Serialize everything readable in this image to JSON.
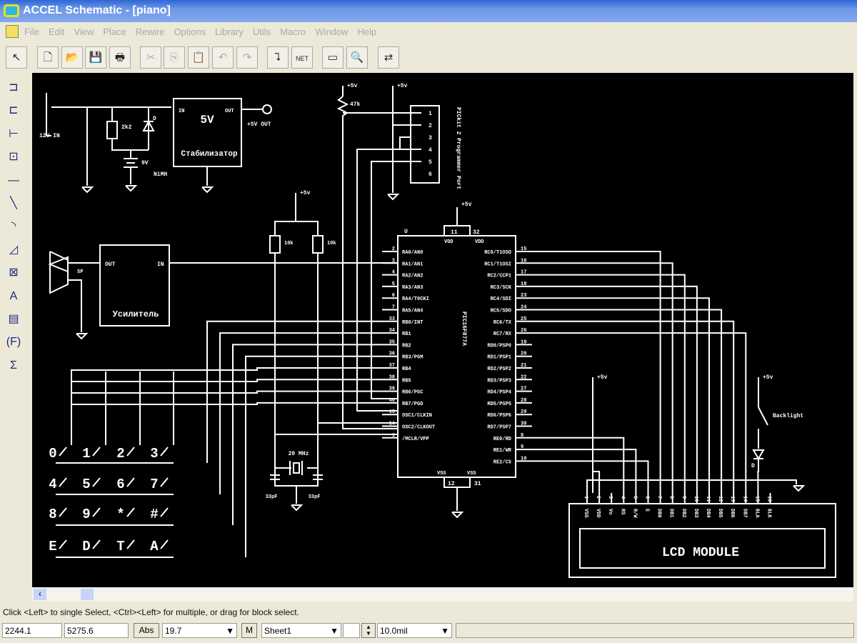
{
  "window": {
    "title": "ACCEL Schematic - [piano]"
  },
  "menu": [
    "File",
    "Edit",
    "View",
    "Place",
    "Rewire",
    "Options",
    "Library",
    "Utils",
    "Macro",
    "Window",
    "Help"
  ],
  "toolbar": [
    {
      "icon": "select-arrow-icon",
      "g": "↖",
      "dis": false
    },
    {
      "icon": "new-file-icon",
      "g": "🗋",
      "dis": false
    },
    {
      "icon": "open-folder-icon",
      "g": "📂",
      "dis": false
    },
    {
      "icon": "save-icon",
      "g": "💾",
      "dis": false
    },
    {
      "icon": "print-icon",
      "g": "🖶",
      "dis": false
    },
    {
      "icon": "cut-icon",
      "g": "✂",
      "dis": true
    },
    {
      "icon": "copy-icon",
      "g": "⎘",
      "dis": true
    },
    {
      "icon": "paste-icon",
      "g": "📋",
      "dis": true
    },
    {
      "icon": "undo-icon",
      "g": "↶",
      "dis": true
    },
    {
      "icon": "redo-icon",
      "g": "↷",
      "dis": true
    },
    {
      "icon": "wire-icon",
      "g": "⮧",
      "dis": false
    },
    {
      "icon": "net-rename-icon",
      "g": "NET",
      "dis": false
    },
    {
      "icon": "ruler-icon",
      "g": "▭",
      "dis": false
    },
    {
      "icon": "zoom-icon",
      "g": "🔍",
      "dis": false
    },
    {
      "icon": "port-swap-icon",
      "g": "⇄",
      "dis": false
    }
  ],
  "left_tools": [
    {
      "icon": "place-part-icon",
      "g": "⊐"
    },
    {
      "icon": "place-pin-icon",
      "g": "⊏"
    },
    {
      "icon": "place-bus-icon",
      "g": "⊢"
    },
    {
      "icon": "place-port-icon",
      "g": "⊡"
    },
    {
      "icon": "place-line-icon",
      "g": "—"
    },
    {
      "icon": "draw-line-icon",
      "g": "╲"
    },
    {
      "icon": "arc-icon",
      "g": "◝"
    },
    {
      "icon": "polygon-icon",
      "g": "◿"
    },
    {
      "icon": "box-icon",
      "g": "⊠"
    },
    {
      "icon": "text-icon",
      "g": "A"
    },
    {
      "icon": "attribute-icon",
      "g": "▤"
    },
    {
      "icon": "field-icon",
      "g": "(F)"
    },
    {
      "icon": "sum-icon",
      "g": "Σ"
    }
  ],
  "schematic": {
    "power": {
      "in_label": "12V IN",
      "r": "2k2",
      "d": "D",
      "bat": "9V",
      "bat_type": "NiMH",
      "reg_value": "5V",
      "reg_in": "IN",
      "reg_out": "OUT",
      "out_label": "+5V OUT",
      "reg_name": "Стабилизатор"
    },
    "programmer": {
      "vcc": "+5v",
      "vcc2": "+5v",
      "r": "47k",
      "title": "PICkit 2 Programmer Port",
      "pins": [
        "1",
        "2",
        "3",
        "4",
        "5",
        "6"
      ]
    },
    "pullups": {
      "vcc": "+5v",
      "r1": "10k",
      "r2": "10k"
    },
    "amp": {
      "out": "OUT",
      "in": "IN",
      "sp": "SP",
      "name": "Усилитель"
    },
    "mcu": {
      "ref": "U",
      "part": "PIC16F877A",
      "vcc": "+5v",
      "vdd1": "VDD",
      "vdd2": "VDD",
      "vss1": "VSS",
      "vss2": "VSS",
      "vdd_pins": [
        "11",
        "32"
      ],
      "vss_pins": [
        "12",
        "31"
      ],
      "left_pins": [
        [
          "2",
          "RA0/AN0"
        ],
        [
          "3",
          "RA1/AN1"
        ],
        [
          "4",
          "RA2/AN2"
        ],
        [
          "5",
          "RA3/AN3"
        ],
        [
          "6",
          "RA4/T0CKI"
        ],
        [
          "7",
          "RA5/AN4"
        ],
        [
          "33",
          "RB0/INT"
        ],
        [
          "34",
          "RB1"
        ],
        [
          "35",
          "RB2"
        ],
        [
          "36",
          "RB3/PGM"
        ],
        [
          "37",
          "RB4"
        ],
        [
          "38",
          "RB5"
        ],
        [
          "39",
          "RB6/PGC"
        ],
        [
          "40",
          "RB7/PGD"
        ],
        [
          "13",
          "OSC1/CLKIN"
        ],
        [
          "14",
          "OSC2/CLKOUT"
        ],
        [
          "1",
          "/MCLR/VPP"
        ]
      ],
      "right_pins": [
        [
          "15",
          "RC0/T1OSO"
        ],
        [
          "16",
          "RC1/T1OSI"
        ],
        [
          "17",
          "RC2/CCP1"
        ],
        [
          "18",
          "RC3/SCK"
        ],
        [
          "23",
          "RC4/SDI"
        ],
        [
          "24",
          "RC5/SDO"
        ],
        [
          "25",
          "RC6/TX"
        ],
        [
          "26",
          "RC7/RX"
        ],
        [
          "19",
          "RD0/PSP0"
        ],
        [
          "20",
          "RD1/PSP1"
        ],
        [
          "21",
          "RD2/PSP2"
        ],
        [
          "22",
          "RD3/PSP3"
        ],
        [
          "27",
          "RD4/PSP4"
        ],
        [
          "28",
          "RD5/PSP5"
        ],
        [
          "29",
          "RD6/PSP6"
        ],
        [
          "30",
          "RD7/PSP7"
        ],
        [
          "8",
          "RE0/RD"
        ],
        [
          "9",
          "RE1/WR"
        ],
        [
          "10",
          "RE2/CS"
        ]
      ]
    },
    "crystal": {
      "freq": "20 MHz",
      "c1": "33pF",
      "c2": "33pF"
    },
    "keypad": [
      [
        "0",
        "1",
        "2",
        "3"
      ],
      [
        "4",
        "5",
        "6",
        "7"
      ],
      [
        "8",
        "9",
        "*",
        "#"
      ],
      [
        "E",
        "D",
        "T",
        "A"
      ]
    ],
    "lcd": {
      "vcc": "+5v",
      "bl_vcc": "+5v",
      "backlight": "Backlight",
      "d": "D",
      "title": "LCD MODULE",
      "pin_numbers": [
        "1",
        "2",
        "3",
        "4",
        "5",
        "6",
        "7",
        "8",
        "9",
        "10",
        "11",
        "12",
        "13",
        "14",
        "15",
        "16"
      ],
      "pin_names": [
        "VSS",
        "VDD",
        "Vo",
        "RS",
        "R/W",
        "E",
        "DB0",
        "DB1",
        "DB2",
        "DB3",
        "DB4",
        "DB5",
        "DB6",
        "DB7",
        "BLA",
        "BLK"
      ]
    }
  },
  "status": {
    "hint": "Click <Left> to single Select, <Ctrl><Left> for multiple, or drag for block select.",
    "x": "2244.1",
    "y": "5275.6",
    "abs": "Abs",
    "zoom": "19.7",
    "m": "M",
    "sheet": "Sheet1",
    "grid": "10.0mil"
  }
}
